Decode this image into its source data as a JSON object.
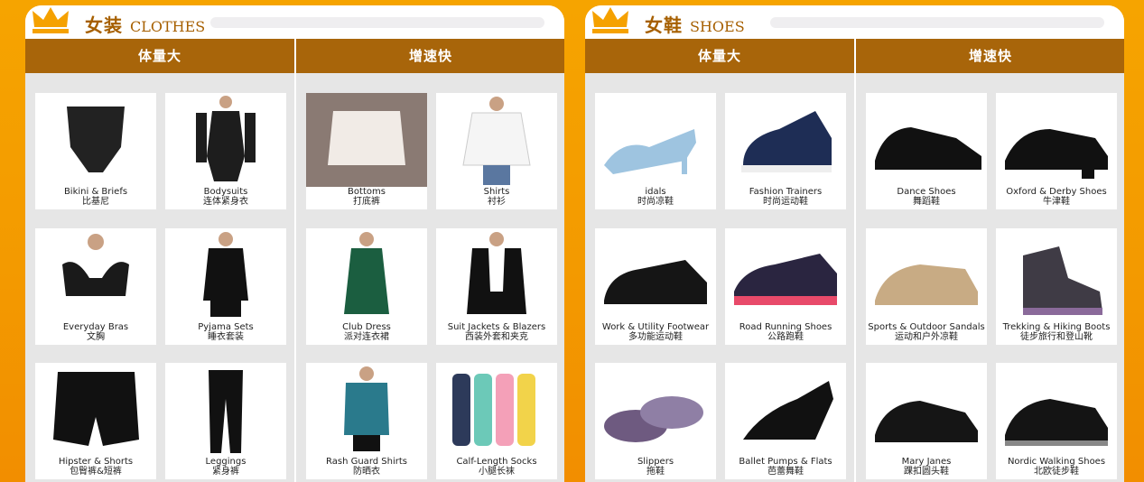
{
  "panels": [
    {
      "title_zh": "女装",
      "title_en": "CLOTHES",
      "columns": [
        {
          "tab": "体量大",
          "items": [
            {
              "en": "Bikini & Briefs",
              "zh": "比基尼",
              "icon": "briefs-icon"
            },
            {
              "en": "Bodysuits",
              "zh": "连体紧身衣",
              "icon": "bodysuit-icon"
            },
            {
              "en": "Everyday Bras",
              "zh": "文胸",
              "icon": "bra-icon"
            },
            {
              "en": "Pyjama Sets",
              "zh": "睡衣套装",
              "icon": "pyjama-icon"
            },
            {
              "en": "Hipster & Shorts",
              "zh": "包臀裤&短裤",
              "icon": "shorts-icon"
            },
            {
              "en": "Leggings",
              "zh": "紧身裤",
              "icon": "leggings-icon"
            }
          ]
        },
        {
          "tab": "增速快",
          "items": [
            {
              "en": "Bottoms",
              "zh": "打底裤",
              "icon": "bottoms-icon"
            },
            {
              "en": "Shirts",
              "zh": "衬衫",
              "icon": "shirt-icon"
            },
            {
              "en": "Club Dress",
              "zh": "派对连衣裙",
              "icon": "dress-icon"
            },
            {
              "en": "Suit Jackets & Blazers",
              "zh": "西装外套和夹克",
              "icon": "blazer-icon"
            },
            {
              "en": "Rash Guard Shirts",
              "zh": "防晒衣",
              "icon": "rashguard-icon"
            },
            {
              "en": "Calf-Length Socks",
              "zh": "小腿长袜",
              "icon": "socks-icon"
            }
          ]
        }
      ]
    },
    {
      "title_zh": "女鞋",
      "title_en": "SHOES",
      "columns": [
        {
          "tab": "体量大",
          "items": [
            {
              "en": "idals",
              "zh": "时尚凉鞋",
              "icon": "sandal-heel-icon"
            },
            {
              "en": "Fashion Trainers",
              "zh": "时尚运动鞋",
              "icon": "trainer-icon"
            },
            {
              "en": "Work & Utility Footwear",
              "zh": "多功能运动鞋",
              "icon": "work-shoe-icon"
            },
            {
              "en": "Road Running Shoes",
              "zh": "公路跑鞋",
              "icon": "running-shoe-icon"
            },
            {
              "en": "Slippers",
              "zh": "拖鞋",
              "icon": "slipper-icon"
            },
            {
              "en": "Ballet Pumps & Flats",
              "zh": "芭蕾舞鞋",
              "icon": "flat-icon"
            }
          ]
        },
        {
          "tab": "增速快",
          "items": [
            {
              "en": "Dance Shoes",
              "zh": "舞蹈鞋",
              "icon": "dance-shoe-icon"
            },
            {
              "en": "Oxford & Derby Shoes",
              "zh": "牛津鞋",
              "icon": "oxford-icon"
            },
            {
              "en": "Sports & Outdoor Sandals",
              "zh": "运动和户外凉鞋",
              "icon": "sport-sandal-icon"
            },
            {
              "en": "Trekking & Hiking Boots",
              "zh": "徒步旅行和登山靴",
              "icon": "hiking-boot-icon"
            },
            {
              "en": "Mary Janes",
              "zh": "踝扣圆头鞋",
              "icon": "mary-jane-icon"
            },
            {
              "en": "Nordic Walking Shoes",
              "zh": "北欧徒步鞋",
              "icon": "walking-shoe-icon"
            }
          ]
        }
      ]
    }
  ]
}
